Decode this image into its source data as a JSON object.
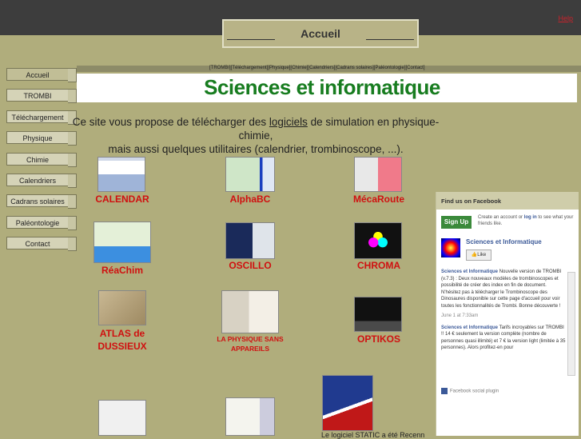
{
  "page": {
    "title": "Accueil",
    "help_link": "Help"
  },
  "top_nav": [
    "[TROMBI]",
    "[Téléchargement]",
    "[Physique]",
    "[Chimie]",
    "[Calendriers]",
    "[Cadrans solaires]",
    "[Paléontologie]",
    "[Contact]"
  ],
  "sidebar": {
    "items": [
      {
        "label": "Accueil"
      },
      {
        "label": "TROMBI"
      },
      {
        "label": "Téléchargement"
      },
      {
        "label": "Physique"
      },
      {
        "label": "Chimie"
      },
      {
        "label": "Calendriers"
      },
      {
        "label": "Cadrans solaires"
      },
      {
        "label": "Paléontologie"
      },
      {
        "label": "Contact"
      }
    ]
  },
  "main": {
    "heading": "Sciences et informatique",
    "intro_prefix": "Ce site vous propose de télécharger des ",
    "intro_link": "logiciels",
    "intro_suffix": " de simulation en physique-chimie,",
    "intro_line2": "mais aussi quelques utilitaires (calendrier, trombinoscope, ...).",
    "apps": [
      {
        "name": "CALENDAR"
      },
      {
        "name": "AlphaBC"
      },
      {
        "name": "MécaRoute"
      },
      {
        "name": "RéaChim"
      },
      {
        "name": "OSCILLO"
      },
      {
        "name": "CHROMA"
      },
      {
        "name": "ATLAS de DUSSIEUX"
      },
      {
        "name": "LA PHYSIQUE SANS APPAREILS"
      },
      {
        "name": "OPTIKOS"
      }
    ],
    "bottom_text": "Le logiciel STATIC a été Recenn"
  },
  "facebook": {
    "title": "Find us on Facebook",
    "signup_label": "Sign Up",
    "signup_text_1": "Create an account or ",
    "signup_login": "log in",
    "signup_text_2": " to see what your friends like.",
    "page_name": "Sciences et Informatique",
    "like_label": "Like",
    "post1_author": "Sciences et Informatique",
    "post1_text": " Nouvelle version de TROMBI (v.7.3) : Deux nouveaux modèles de trombinoscopes et possibilité de créer des index en fin de document. N'hésitez pas à télécharger le Trombinoscope des Dinosaures disponible sur cette page d'accueil pour voir toutes les fonctionnalités de Trombi. Bonne découverte !",
    "post1_date": "June 1 at 7:33am",
    "post2_author": "Sciences et Informatique",
    "post2_text": " Tarifs incroyables sur TROMBI !! 14 € seulement la version complète (nombre de personnes quasi illimité) et 7 € la version light (limitée à 35 personnes). Alors profitez-en pour",
    "footer": "Facebook social plugin"
  },
  "colors": {
    "accent": "#177c1f",
    "link_red": "#d01010",
    "background": "#b0ad7c"
  }
}
